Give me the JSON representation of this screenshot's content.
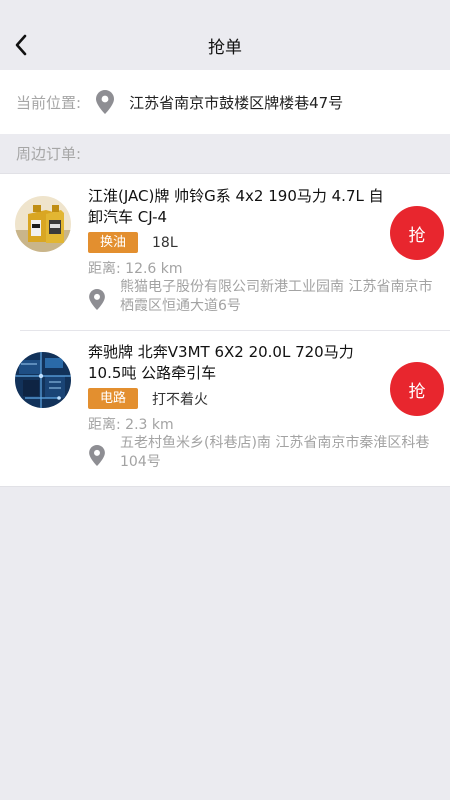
{
  "nav": {
    "title": "抢单",
    "back_icon": "chevron-left-icon"
  },
  "location": {
    "label": "当前位置:",
    "icon": "location-pin-icon",
    "value": "江苏省南京市鼓楼区牌楼巷47号"
  },
  "nearby": {
    "label": "周边订单:"
  },
  "orders": [
    {
      "title": "江淮(JAC)牌 帅铃G系 4x2 190马力 4.7L 自卸汽车 CJ-4",
      "tag": "换油",
      "tag_desc": "18L",
      "distance": "距离: 12.6 km",
      "address": "熊猫电子股份有限公司新港工业园南 江苏省南京市栖霞区恒通大道6号",
      "button": "抢",
      "avatar": "engine-oil-image",
      "tag_color": "#E38F2F"
    },
    {
      "title": "奔驰牌 北奔V3MT 6X2 20.0L 720马力 10.5吨 公路牵引车",
      "tag": "电路",
      "tag_desc": "打不着火",
      "distance": "距离: 2.3 km",
      "address": "五老村鱼米乡(科巷店)南 江苏省南京市秦淮区科巷104号",
      "button": "抢",
      "avatar": "circuit-board-image",
      "tag_color": "#E38F2F"
    }
  ],
  "colors": {
    "accent_red": "#E8262E",
    "tag_orange": "#E38F2F",
    "background": "#EBEBF0",
    "muted_text": "#A3A3A3"
  }
}
